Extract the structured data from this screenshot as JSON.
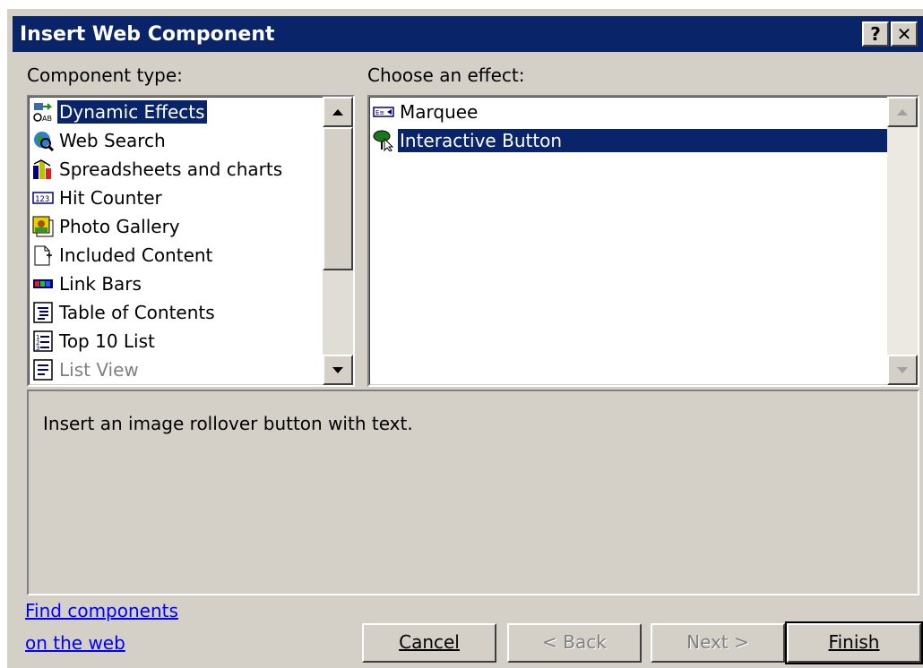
{
  "window": {
    "title": "Insert Web Component",
    "help_glyph": "?",
    "close_glyph": "✕"
  },
  "component_type": {
    "label": "Component type:",
    "items": [
      {
        "label": "Dynamic Effects",
        "icon": "dynamic-effects-icon",
        "selected": true
      },
      {
        "label": "Web Search",
        "icon": "web-search-icon"
      },
      {
        "label": "Spreadsheets and charts",
        "icon": "spreadsheets-charts-icon"
      },
      {
        "label": "Hit Counter",
        "icon": "hit-counter-icon"
      },
      {
        "label": "Photo Gallery",
        "icon": "photo-gallery-icon"
      },
      {
        "label": "Included Content",
        "icon": "included-content-icon"
      },
      {
        "label": "Link Bars",
        "icon": "link-bars-icon"
      },
      {
        "label": "Table of Contents",
        "icon": "table-of-contents-icon"
      },
      {
        "label": "Top 10 List",
        "icon": "top-10-list-icon"
      },
      {
        "label": "List View",
        "icon": "list-view-icon",
        "disabled": true
      }
    ]
  },
  "effect": {
    "label": "Choose an effect:",
    "items": [
      {
        "label": "Marquee",
        "icon": "marquee-icon"
      },
      {
        "label": "Interactive Button",
        "icon": "interactive-button-icon",
        "selected": true
      }
    ]
  },
  "description": "Insert an image rollover button with text.",
  "find_link": {
    "line1": "Find components",
    "line2": "on the web"
  },
  "buttons": {
    "cancel": "Cancel",
    "back": "< Back",
    "next": "Next >",
    "finish": "Finish"
  },
  "colors": {
    "title_bar": "#0a246a",
    "face": "#d4d0c8",
    "selection": "#0a246a",
    "link": "#0000ff"
  }
}
